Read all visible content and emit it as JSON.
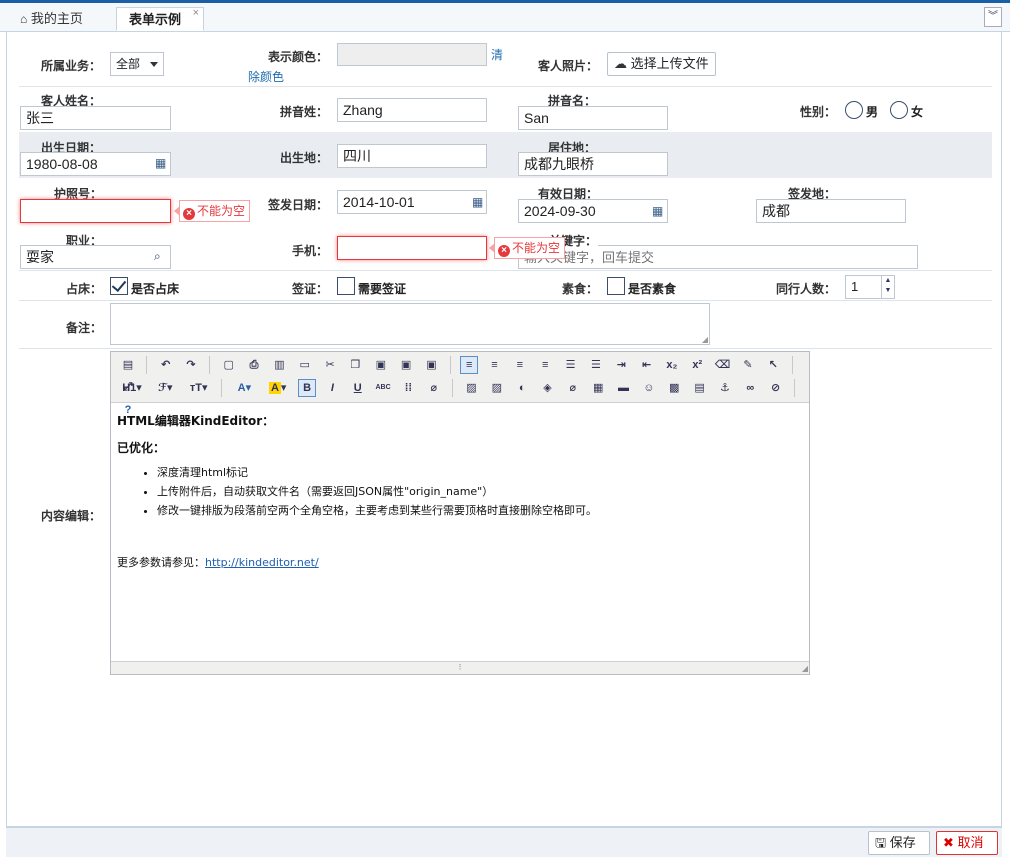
{
  "tabs": [
    {
      "label": "我的主页",
      "icon": "home-icon"
    },
    {
      "label": "表单示例",
      "close": "×"
    }
  ],
  "form": {
    "business": {
      "label": "所属业务：",
      "value": "全部"
    },
    "color": {
      "label": "表示颜色：",
      "clear_link_1": "清",
      "clear_link_2": "除颜色"
    },
    "photo": {
      "label": "客人照片：",
      "button": "选择上传文件"
    },
    "guest_name": {
      "label": "客人姓名：",
      "value": "张三"
    },
    "pinyin_last": {
      "label": "拼音姓：",
      "value": "Zhang"
    },
    "pinyin_first": {
      "label": "拼音名：",
      "value": "San"
    },
    "gender": {
      "label": "性别：",
      "options": [
        "男",
        "女"
      ]
    },
    "birth_date": {
      "label": "出生日期：",
      "value": "1980-08-08"
    },
    "birth_place": {
      "label": "出生地：",
      "value": "四川"
    },
    "residence": {
      "label": "居住地：",
      "value": "成都九眼桥"
    },
    "passport": {
      "label": "护照号：",
      "value": "",
      "error": "不能为空"
    },
    "issue_date": {
      "label": "签发日期：",
      "value": "2014-10-01"
    },
    "expiry_date": {
      "label": "有效日期：",
      "value": "2024-09-30"
    },
    "issue_place": {
      "label": "签发地：",
      "value": "成都"
    },
    "job": {
      "label": "职业：",
      "value": "耍家"
    },
    "mobile": {
      "label": "手机：",
      "value": "",
      "error": "不能为空"
    },
    "keyword": {
      "label": "关键字：",
      "placeholder": "输入关键字，回车提交"
    },
    "bed": {
      "label": "占床：",
      "option": "是否占床",
      "checked": true
    },
    "visa": {
      "label": "签证：",
      "option": "需要签证",
      "checked": false
    },
    "vegetarian": {
      "label": "素食：",
      "option": "是否素食",
      "checked": false
    },
    "companions": {
      "label": "同行人数：",
      "value": "1"
    },
    "remark": {
      "label": "备注："
    },
    "content": {
      "label": "内容编辑："
    }
  },
  "editor": {
    "toolbar_text": {
      "h1": "H1",
      "font": "ℱ",
      "size": "тT",
      "font_color": "A",
      "highlight": "A",
      "bold": "B",
      "italic": "I",
      "underline": "U",
      "strike": "ABC"
    },
    "title": "HTML编辑器KindEditor：",
    "optimized": "已优化：",
    "items": [
      "深度清理html标记",
      "上传附件后，自动获取文件名（需要返回JSON属性\"origin_name\"）",
      "修改一键排版为段落前空两个全角空格，主要考虑到某些行需要顶格时直接删除空格即可。"
    ],
    "more_prefix": "更多参数请参见：",
    "more_link": "http://kindeditor.net/"
  },
  "footer": {
    "save": "保存",
    "cancel": "取消"
  },
  "colors": {
    "accent": "#1a5fa6",
    "error": "#e4393c",
    "link": "#1e6cae"
  }
}
